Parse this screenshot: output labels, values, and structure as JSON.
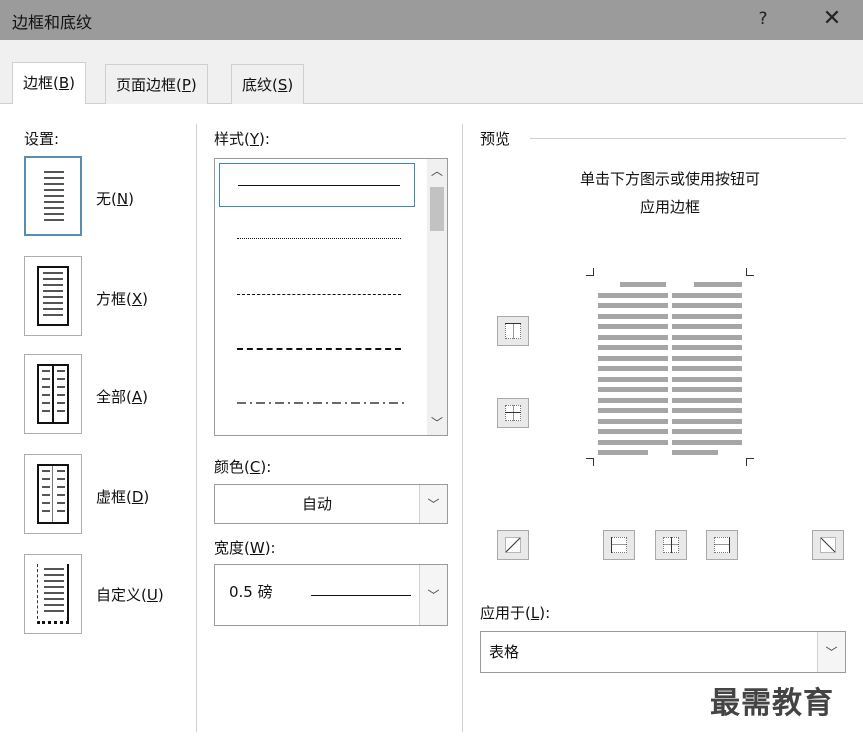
{
  "window": {
    "title": "边框和底纹",
    "help": "?",
    "close": "✕"
  },
  "tabs": [
    {
      "label": "边框(",
      "key": "B",
      "end": ")"
    },
    {
      "label": "页面边框(",
      "key": "P",
      "end": ")"
    },
    {
      "label": "底纹(",
      "key": "S",
      "end": ")"
    }
  ],
  "setting": {
    "heading": "设置:",
    "items": [
      {
        "label": "无(",
        "key": "N",
        "end": ")"
      },
      {
        "label": "方框(",
        "key": "X",
        "end": ")"
      },
      {
        "label": "全部(",
        "key": "A",
        "end": ")"
      },
      {
        "label": "虚框(",
        "key": "D",
        "end": ")"
      },
      {
        "label": "自定义(",
        "key": "U",
        "end": ")"
      }
    ]
  },
  "style": {
    "heading_pre": "样式(",
    "heading_key": "Y",
    "heading_end": "):",
    "line_styles": [
      "solid",
      "dotted",
      "small-dash",
      "dash",
      "dash-dot"
    ]
  },
  "color": {
    "heading_pre": "颜色(",
    "heading_key": "C",
    "heading_end": "):",
    "value": "自动"
  },
  "width": {
    "heading_pre": "宽度(",
    "heading_key": "W",
    "heading_end": "):",
    "value": "0.5 磅"
  },
  "preview": {
    "heading": "预览",
    "hint_line1": "单击下方图示或使用按钮可",
    "hint_line2": "应用边框"
  },
  "apply_to": {
    "heading_pre": "应用于(",
    "heading_key": "L",
    "heading_end": "):",
    "value": "表格"
  },
  "watermark": "最需教育",
  "colors": {
    "titlebar": "#9b9b9b",
    "selection": "#3a86c8",
    "preview_bars": "#a6a6a6"
  }
}
